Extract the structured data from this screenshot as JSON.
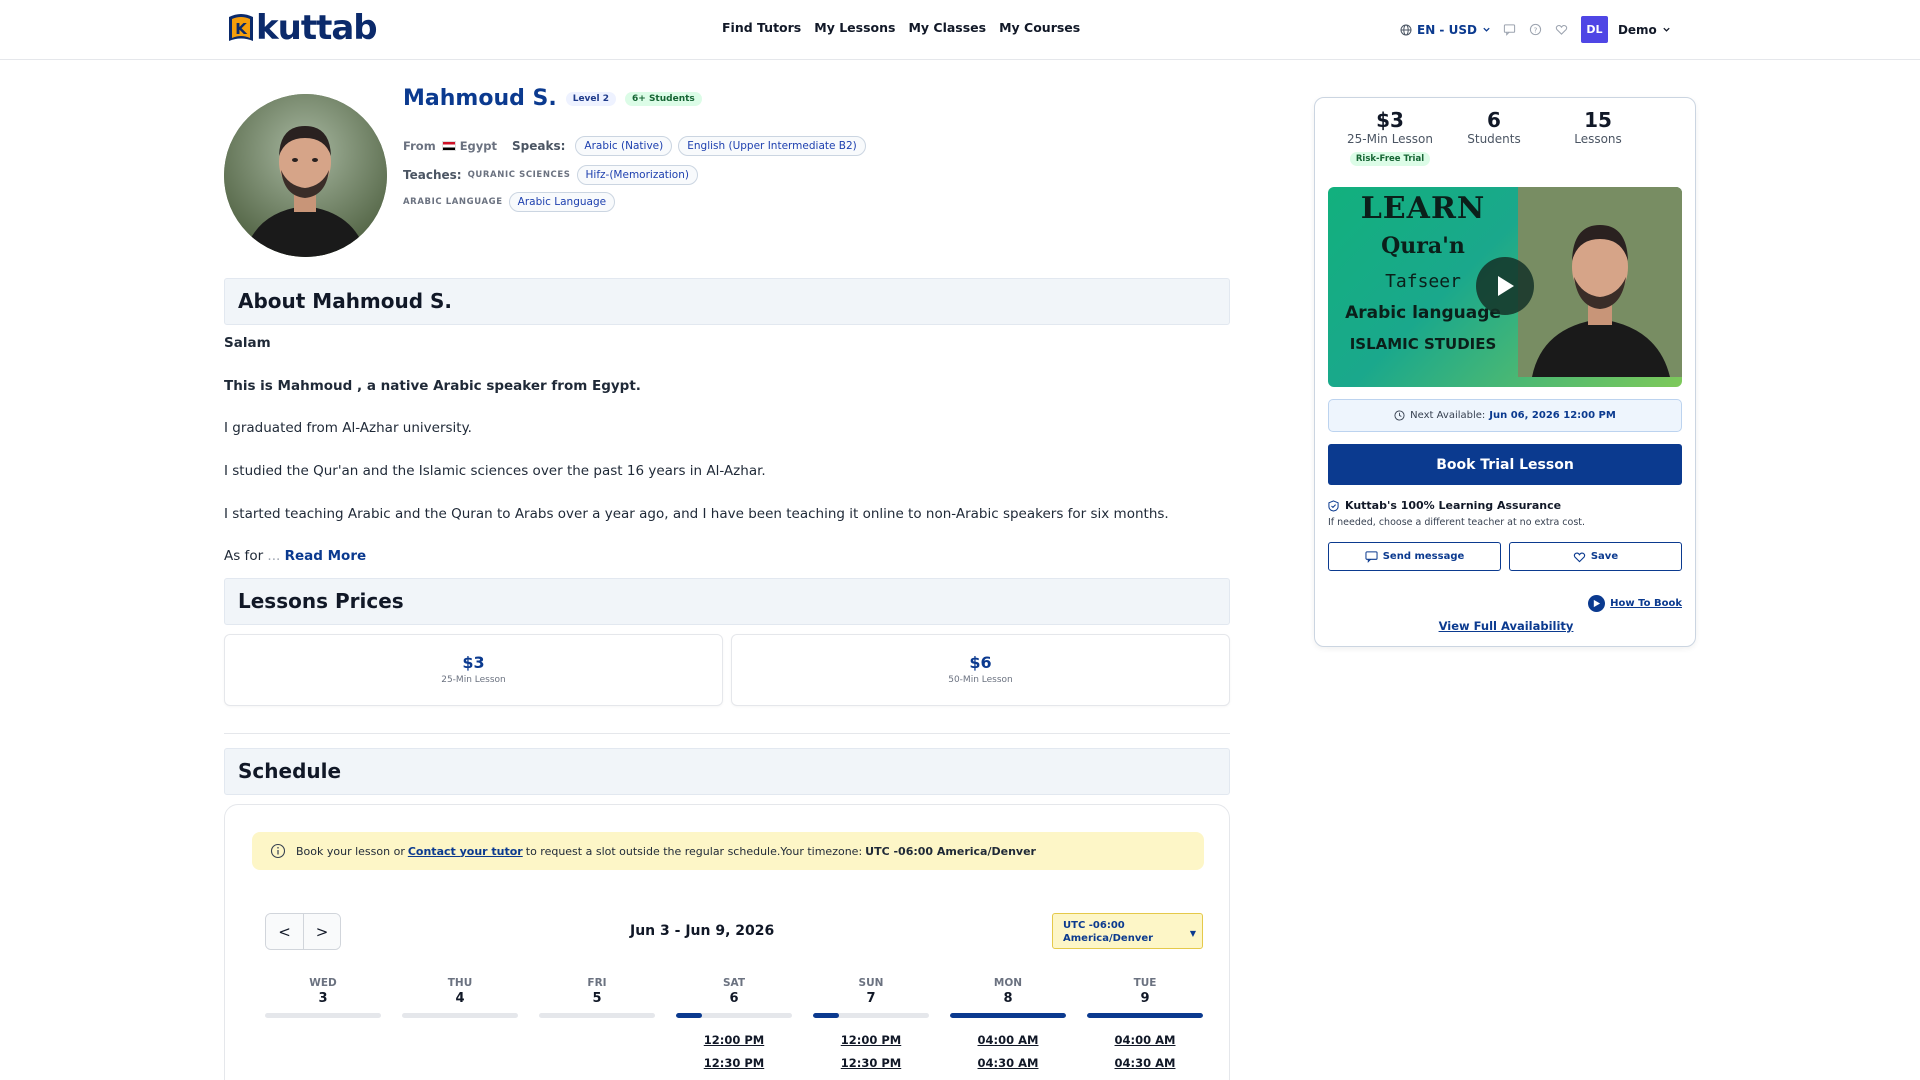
{
  "header": {
    "logo_text": "kuttab",
    "logo_letter": "K",
    "nav": [
      "Find Tutors",
      "My Lessons",
      "My Classes",
      "My Courses"
    ],
    "language": "EN - USD",
    "user_initials": "DL",
    "user_name": "Demo"
  },
  "profile": {
    "name": "Mahmoud S.",
    "level": "Level 2",
    "students_badge": "6+ Students",
    "from_label": "From",
    "country": "Egypt",
    "speaks_label": "Speaks:",
    "languages": [
      "Arabic (Native)",
      "English (Upper Intermediate B2)"
    ],
    "teaches_label": "Teaches:",
    "teach_categories": [
      {
        "category": "QURANIC SCIENCES",
        "subject": "Hifz-(Memorization)"
      },
      {
        "category": "ARABIC LANGUAGE",
        "subject": "Arabic Language"
      }
    ]
  },
  "about": {
    "title": "About Mahmoud S.",
    "paragraphs": [
      "Salam",
      "This is Mahmoud , a native Arabic speaker from Egypt.",
      "I graduated from Al-Azhar university.",
      "I studied the Qur'an and the Islamic sciences over the past 16 years in Al-Azhar.",
      "I started teaching Arabic and the Quran to Arabs over a year ago, and I have been teaching it online to non-Arabic speakers for six months."
    ],
    "truncated_text": "As for",
    "ellipsis": "...",
    "read_more": "Read More"
  },
  "prices": {
    "title": "Lessons Prices",
    "items": [
      {
        "amount": "$3",
        "label": "25-Min Lesson"
      },
      {
        "amount": "$6",
        "label": "50-Min Lesson"
      }
    ]
  },
  "schedule": {
    "title": "Schedule",
    "notice_pre": "Book your lesson or",
    "notice_link": "Contact your tutor",
    "notice_post": "to request a slot outside the regular schedule.Your timezone:",
    "notice_tz": "UTC -06:00 America/Denver",
    "prev": "<",
    "next": ">",
    "week_range": "Jun 3 - Jun 9, 2026",
    "tz_line1": "UTC -06:00",
    "tz_line2": "America/Denver",
    "days": [
      {
        "name": "WED",
        "num": "3",
        "availability": 0,
        "slots": []
      },
      {
        "name": "THU",
        "num": "4",
        "availability": 0,
        "slots": []
      },
      {
        "name": "FRI",
        "num": "5",
        "availability": 0,
        "slots": []
      },
      {
        "name": "SAT",
        "num": "6",
        "availability": 0.22,
        "slots": [
          "12:00 PM",
          "12:30 PM"
        ]
      },
      {
        "name": "SUN",
        "num": "7",
        "availability": 0.22,
        "slots": [
          "12:00 PM",
          "12:30 PM"
        ]
      },
      {
        "name": "MON",
        "num": "8",
        "availability": 1,
        "slots": [
          "04:00 AM",
          "04:30 AM"
        ]
      },
      {
        "name": "TUE",
        "num": "9",
        "availability": 1,
        "slots": [
          "04:00 AM",
          "04:30 AM"
        ]
      }
    ]
  },
  "sidebar": {
    "stats": [
      {
        "value": "$3",
        "label": "25-Min Lesson",
        "badge": "Risk-Free Trial"
      },
      {
        "value": "6",
        "label": "Students"
      },
      {
        "value": "15",
        "label": "Lessons"
      }
    ],
    "video_lines": [
      "LEARN",
      "Qura'n",
      "Tafseer",
      "Arabic language",
      "ISLAMIC STUDIES"
    ],
    "next_available_label": "Next Available:",
    "next_available_value": "Jun 06, 2026 12:00 PM",
    "book_button": "Book Trial Lesson",
    "assurance_title": "Kuttab's 100% Learning Assurance",
    "assurance_sub": "If needed, choose a different teacher at no extra cost.",
    "send_message": "Send message",
    "save": "Save",
    "how_to_book": "How To Book",
    "view_full": "View Full Availability"
  },
  "colors": {
    "brand_blue": "#0b3a8f",
    "accent_orange": "#f59e0b",
    "notice_yellow": "#fdf6c7",
    "success_green": "#dcfce7"
  }
}
